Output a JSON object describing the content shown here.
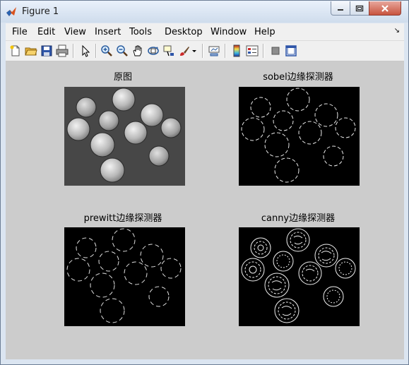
{
  "window": {
    "title": "Figure 1"
  },
  "menu": {
    "items": [
      "File",
      "Edit",
      "View",
      "Insert",
      "Tools",
      "Desktop",
      "Window",
      "Help"
    ]
  },
  "toolbar": {
    "icons": [
      "new-figure-icon",
      "open-file-icon",
      "save-icon",
      "print-icon",
      "edit-plot-icon",
      "zoom-in-icon",
      "zoom-out-icon",
      "pan-icon",
      "rotate-3d-icon",
      "data-cursor-icon",
      "brush-icon",
      "brush-dropdown-icon",
      "link-plot-icon",
      "insert-colorbar-icon",
      "insert-legend-icon",
      "hide-plot-tools-icon",
      "show-plot-tools-icon"
    ]
  },
  "axes": [
    {
      "title": "原图"
    },
    {
      "title": "sobel边缘探测器"
    },
    {
      "title": "prewitt边缘探测器"
    },
    {
      "title": "canny边缘探测器"
    }
  ],
  "colors": {
    "figure_background": "#cccccc",
    "titlebar_top": "#e9f1fb",
    "close_button": "#c8543f"
  }
}
